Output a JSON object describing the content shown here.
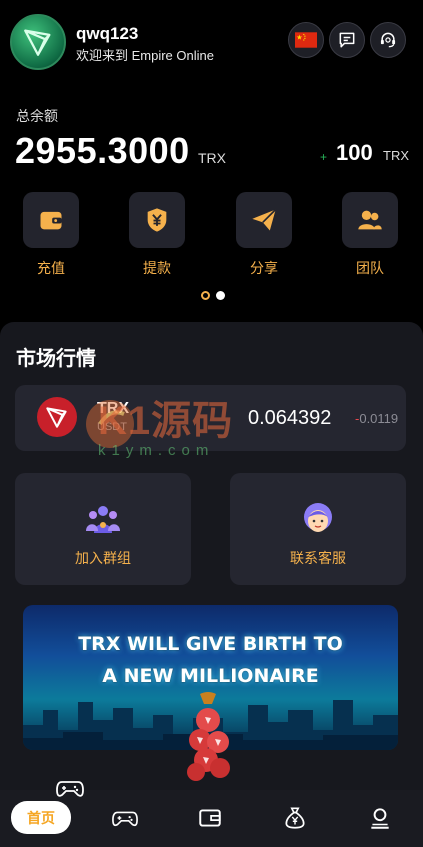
{
  "header": {
    "username": "qwq123",
    "welcome": "欢迎来到 Empire Online",
    "icons": [
      "flag-china-icon",
      "message-icon",
      "customer-service-icon"
    ]
  },
  "balance": {
    "label": "总余额",
    "value": "2955.3000",
    "unit": "TRX",
    "bonus_sign": "+",
    "bonus_value": "100",
    "bonus_unit": "TRX"
  },
  "actions": [
    {
      "label": "充值",
      "icon": "wallet-icon"
    },
    {
      "label": "提款",
      "icon": "yuan-shield-icon"
    },
    {
      "label": "分享",
      "icon": "paper-plane-icon"
    },
    {
      "label": "团队",
      "icon": "team-icon"
    }
  ],
  "carousel": {
    "pages": 2,
    "active": 0
  },
  "market": {
    "title": "市场行情",
    "ticker": {
      "symbol": "TRX",
      "quote": "USDT",
      "price": "0.064392",
      "change_sign": "-",
      "change": "0.0119"
    }
  },
  "watermark": {
    "text": "K1源码",
    "sub": "k1ym.com"
  },
  "cards": [
    {
      "label": "加入群组",
      "icon": "group-icon"
    },
    {
      "label": "联系客服",
      "icon": "support-agent-icon"
    }
  ],
  "banner": {
    "line1": "TRX WILL GIVE BIRTH  TO",
    "line2": "A NEW MILLIONAIRE"
  },
  "tabbar": {
    "home_label": "首页",
    "tabs": [
      "gamepad-icon",
      "wallet-icon",
      "money-bag-icon",
      "user-icon"
    ]
  },
  "colors": {
    "accent": "#f5b14c",
    "background": "#000000",
    "panel": "#17181e",
    "card": "#252630",
    "positive": "#27b35a",
    "negative": "#e5484d"
  }
}
